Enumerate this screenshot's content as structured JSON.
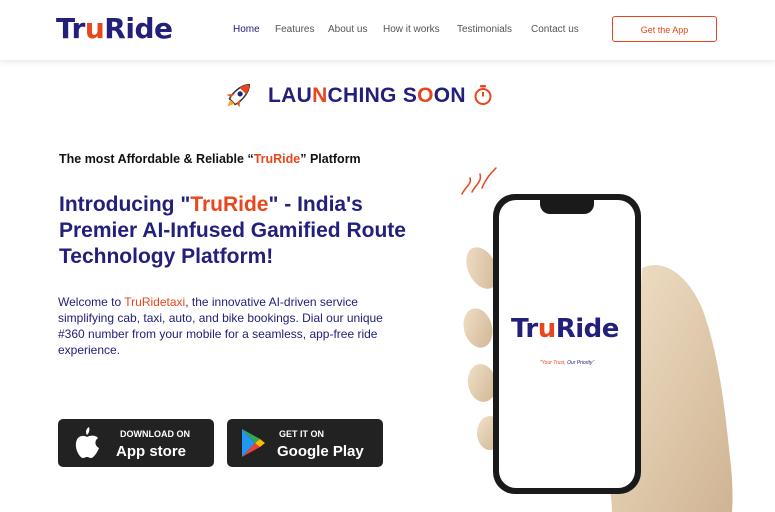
{
  "header": {
    "logo": {
      "part1": "Tr",
      "part2": "u",
      "part3": "Ride"
    },
    "nav": [
      {
        "label": "Home"
      },
      {
        "label": "Features"
      },
      {
        "label": "About us"
      },
      {
        "label": "How it works"
      },
      {
        "label": "Testimonials"
      },
      {
        "label": "Contact us"
      }
    ],
    "cta": "Get the App"
  },
  "launch": {
    "a": "LAU",
    "b": "N",
    "c": "CHING S",
    "d": "O",
    "e": "ON",
    "icons": [
      "rocket-icon",
      "stopwatch-icon"
    ]
  },
  "tagline": {
    "pre": "The most Affordable & Reliable “",
    "brand": "TruRide",
    "post": "” Platform"
  },
  "headline": {
    "pre": "Introducing \"",
    "brand": "TruRide",
    "post": "\" - India's Premier AI-Infused Gamified Route Technology Platform!"
  },
  "description": {
    "pre": "Welcome to ",
    "brand": "TruRidetaxi",
    "post": ", the innovative AI-driven service simplifying cab, taxi, auto, and bike bookings. Dial our unique #360 number from your mobile for a seamless, app-free ride experience."
  },
  "stores": {
    "apple": {
      "small": "DOWNLOAD ON",
      "big": "App store",
      "icon": "apple-icon"
    },
    "google": {
      "small": "GET IT ON",
      "big": "Google Play",
      "icon": "google-play-icon"
    }
  },
  "phone": {
    "logo": {
      "part1": "Tr",
      "part2": "u",
      "part3": "Ride"
    },
    "slogan": {
      "a": "\"Your Trust, ",
      "b": "Our Priority",
      "c": "\""
    }
  },
  "colors": {
    "brand_blue": "#22207a",
    "accent_orange": "#e8461c"
  }
}
